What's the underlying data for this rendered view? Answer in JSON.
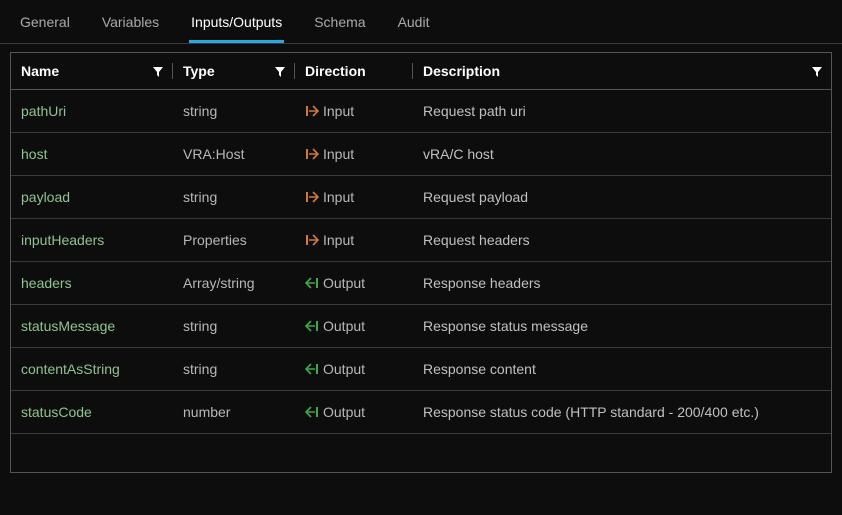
{
  "tabs": [
    {
      "label": "General",
      "active": false
    },
    {
      "label": "Variables",
      "active": false
    },
    {
      "label": "Inputs/Outputs",
      "active": true
    },
    {
      "label": "Schema",
      "active": false
    },
    {
      "label": "Audit",
      "active": false
    }
  ],
  "columns": {
    "name": "Name",
    "type": "Type",
    "direction": "Direction",
    "description": "Description"
  },
  "rows": [
    {
      "name": "pathUri",
      "type": "string",
      "direction": "Input",
      "dirKind": "in",
      "description": "Request path uri"
    },
    {
      "name": "host",
      "type": "VRA:Host",
      "direction": "Input",
      "dirKind": "in",
      "description": "vRA/C host"
    },
    {
      "name": "payload",
      "type": "string",
      "direction": "Input",
      "dirKind": "in",
      "description": "Request payload"
    },
    {
      "name": "inputHeaders",
      "type": "Properties",
      "direction": "Input",
      "dirKind": "in",
      "description": "Request headers"
    },
    {
      "name": "headers",
      "type": "Array/string",
      "direction": "Output",
      "dirKind": "out",
      "description": "Response headers"
    },
    {
      "name": "statusMessage",
      "type": "string",
      "direction": "Output",
      "dirKind": "out",
      "description": "Response status message"
    },
    {
      "name": "contentAsString",
      "type": "string",
      "direction": "Output",
      "dirKind": "out",
      "description": "Response content"
    },
    {
      "name": "statusCode",
      "type": "number",
      "direction": "Output",
      "dirKind": "out",
      "description": "Response status code (HTTP standard - 200/400 etc.)"
    }
  ],
  "colors": {
    "inputIcon": "#d07a3a",
    "outputIcon": "#3fa84a"
  }
}
